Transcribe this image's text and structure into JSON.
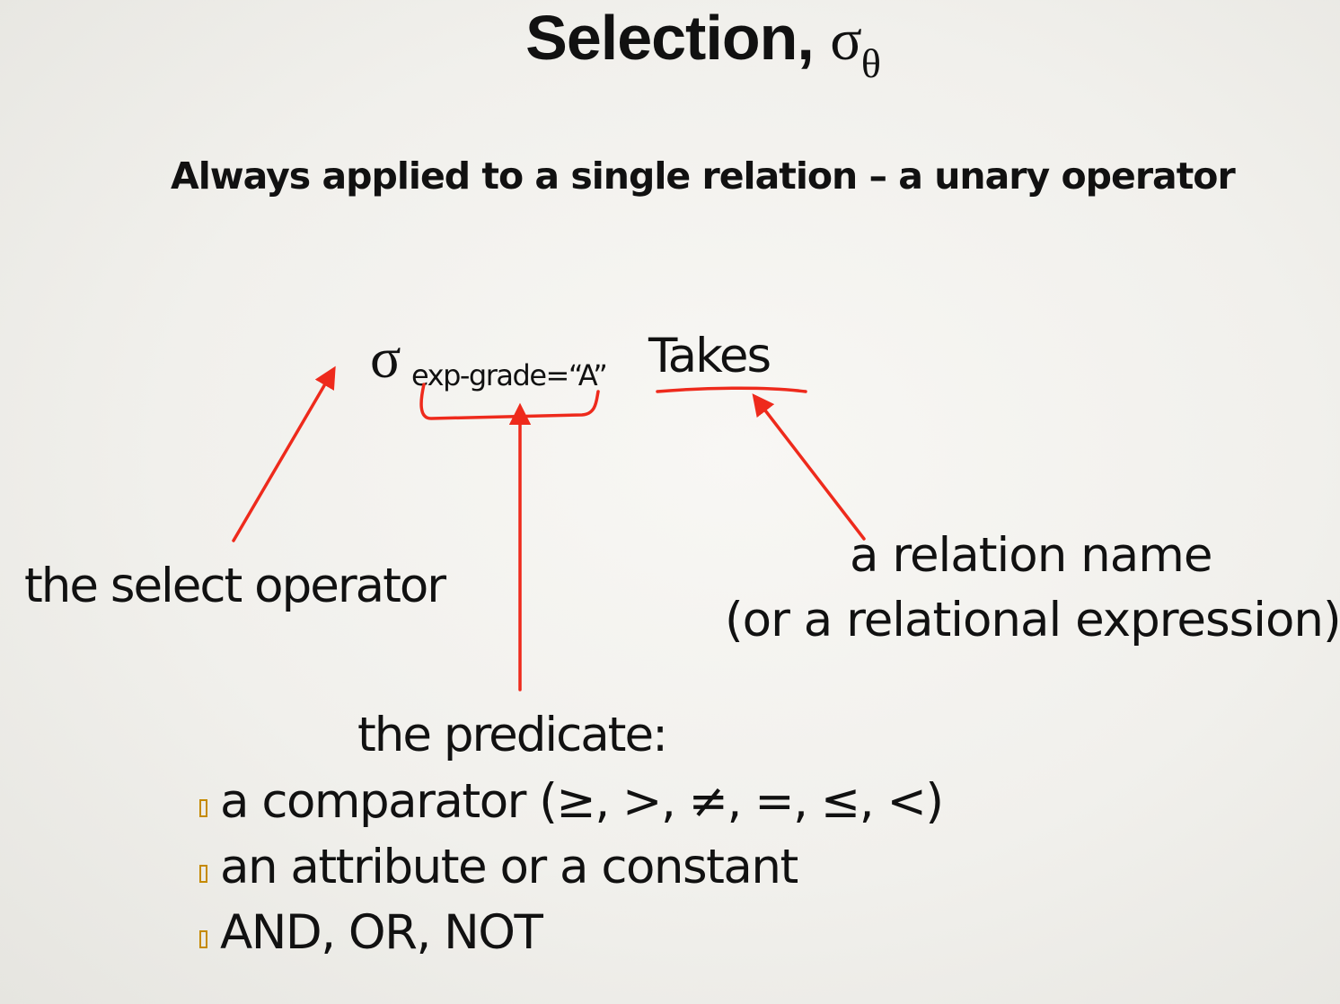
{
  "title": {
    "text": "Selection, ",
    "symbol": "σ",
    "subscript": "θ"
  },
  "subtitle": "Always applied to a single relation – a unary operator",
  "formula": {
    "operator_symbol": "σ",
    "predicate": "exp-grade=“A”",
    "relation": "Takes"
  },
  "labels": {
    "select_operator": "the select operator",
    "relation_line1": "a relation name",
    "relation_line2": "(or a relational expression)",
    "predicate_heading": "the predicate:"
  },
  "predicate_bullets": [
    "a comparator (≥, >, ≠, =, ≤, <)",
    "an attribute or a constant",
    "AND, OR, NOT"
  ],
  "colors": {
    "annotation": "#ee2a1c",
    "bullet": "#c58a00",
    "text": "#111111"
  }
}
